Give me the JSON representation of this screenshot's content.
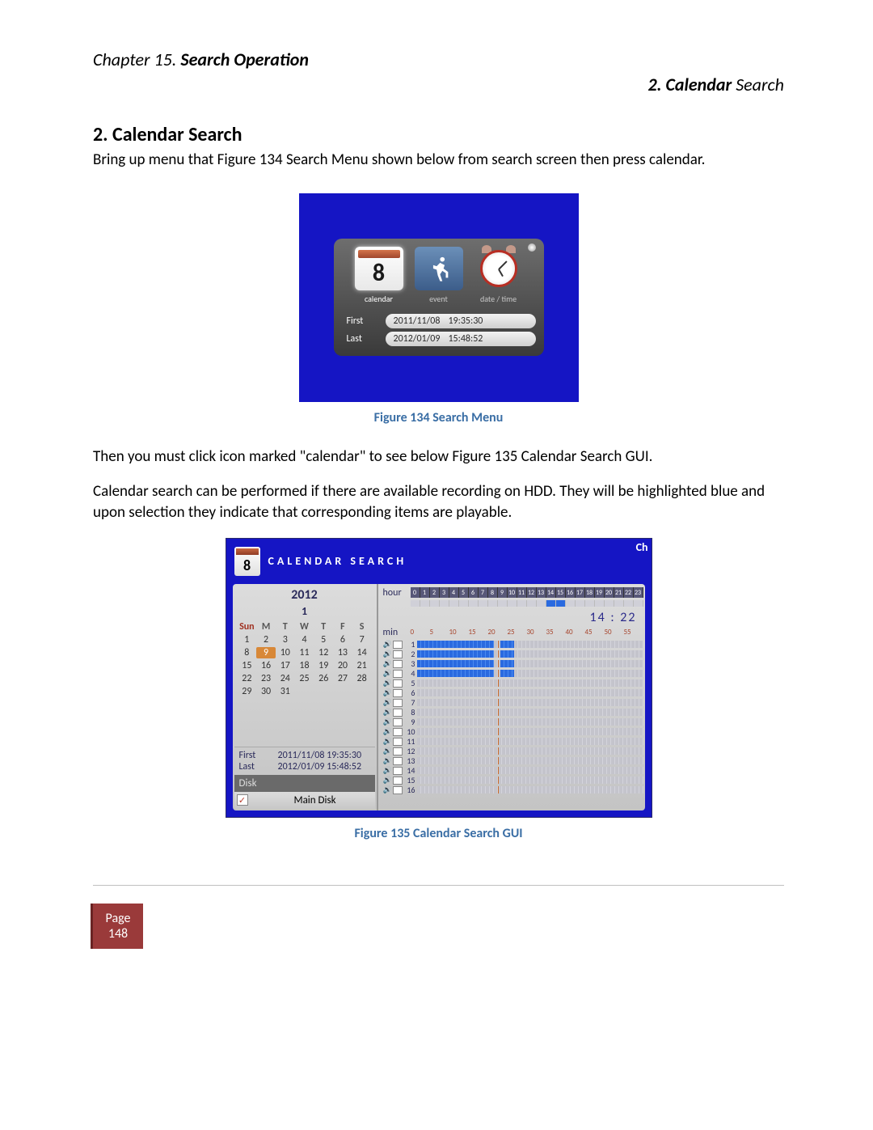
{
  "doc": {
    "chapter_prefix": "Chapter 15. ",
    "chapter_bold": "Search Operation",
    "section_right_bold": "2.  Calendar ",
    "section_right_thin": "Search",
    "section_title": "2.  Calendar Search",
    "para1": "Bring up menu that Figure 134 Search Menu shown below from search screen then press calendar.",
    "fig134_caption": "Figure 134 Search Menu",
    "para2": "Then you must click icon marked \"calendar\" to see below Figure 135 Calendar Search GUI.",
    "para3": "Calendar search can be performed if there are available recording on HDD. They will be highlighted blue and upon selection they indicate that corresponding items are playable.",
    "fig135_caption": "Figure 135 Calendar Search GUI",
    "page_label": "Page",
    "page_number": "148"
  },
  "fig134": {
    "cal_num": "8",
    "labels": {
      "calendar": "calendar",
      "event": "event",
      "datetime": "date / time"
    },
    "first_label": "First",
    "last_label": "Last",
    "first_date": "2011/11/08",
    "first_time": "19:35:30",
    "last_date": "2012/01/09",
    "last_time": "15:48:52"
  },
  "fig135": {
    "corner": "Ch",
    "cal_num": "8",
    "title": "CALENDAR SEARCH",
    "year": "2012",
    "month": "1",
    "dow": [
      "Sun",
      "M",
      "T",
      "W",
      "T",
      "F",
      "S"
    ],
    "days": [
      [
        1,
        2,
        3,
        4,
        5,
        6,
        7
      ],
      [
        8,
        9,
        10,
        11,
        12,
        13,
        14
      ],
      [
        15,
        16,
        17,
        18,
        19,
        20,
        21
      ],
      [
        22,
        23,
        24,
        25,
        26,
        27,
        28
      ],
      [
        29,
        30,
        31,
        null,
        null,
        null,
        null
      ]
    ],
    "selected_day": 9,
    "first_label": "First",
    "first_value": "2011/11/08 19:35:30",
    "last_label": "Last",
    "last_value": "2012/01/09 15:48:52",
    "disk_label": "Disk",
    "disk_name": "Main Disk",
    "hour_label": "hour",
    "hours": [
      0,
      1,
      2,
      3,
      4,
      5,
      6,
      7,
      8,
      9,
      10,
      11,
      12,
      13,
      14,
      15,
      16,
      17,
      18,
      19,
      20,
      21,
      22,
      23
    ],
    "bar_on": [
      14,
      15
    ],
    "time_display": "14 : 22",
    "min_label": "min",
    "min_ticks": [
      "0",
      "5",
      "10",
      "15",
      "20",
      "25",
      "30",
      "35",
      "40",
      "45",
      "50",
      "55"
    ],
    "channels": [
      1,
      2,
      3,
      4,
      5,
      6,
      7,
      8,
      9,
      10,
      11,
      12,
      13,
      14,
      15,
      16
    ],
    "channels_with_data": [
      1,
      2,
      3,
      4
    ]
  }
}
